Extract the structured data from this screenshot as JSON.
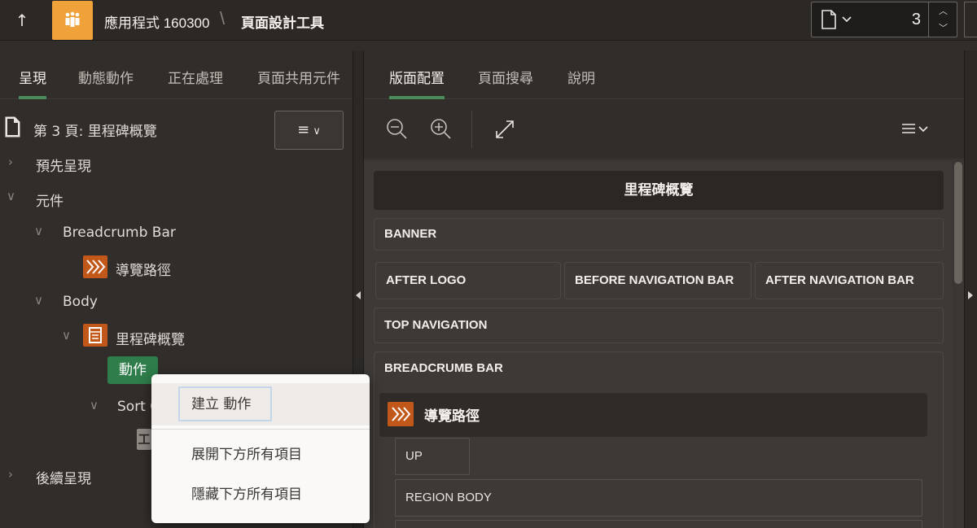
{
  "header": {
    "app_name": "應用程式 160300",
    "separator": "\\",
    "tool_name": "頁面設計工具",
    "page_number": "3"
  },
  "left_tabs": [
    {
      "label": "呈現",
      "active": true
    },
    {
      "label": "動態動作",
      "active": false
    },
    {
      "label": "正在處理",
      "active": false
    },
    {
      "label": "頁面共用元件",
      "active": false
    }
  ],
  "tree": {
    "page_label": "第 3 頁: 里程碑概覽",
    "pre_rendering": "預先呈現",
    "components": "元件",
    "breadcrumb_bar": "Breadcrumb Bar",
    "breadcrumb_item": "導覽路徑",
    "body": "Body",
    "region": "里程碑概覽",
    "actions_badge": "動作",
    "sort_partial": "Sort C",
    "grey_badge": "工",
    "post_rendering": "後續呈現"
  },
  "right_tabs": [
    {
      "label": "版面配置",
      "active": true
    },
    {
      "label": "頁面搜尋",
      "active": false
    },
    {
      "label": "說明",
      "active": false
    }
  ],
  "layout": {
    "page_title": "里程碑概覽",
    "banner": "BANNER",
    "after_logo": "AFTER LOGO",
    "before_nav": "BEFORE NAVIGATION BAR",
    "after_nav": "AFTER NAVIGATION BAR",
    "top_nav": "TOP NAVIGATION",
    "breadcrumb_bar": "BREADCRUMB BAR",
    "breadcrumb_region": "導覽路徑",
    "up": "UP",
    "region_body": "REGION BODY"
  },
  "context_menu": {
    "create_action": "建立 動作",
    "expand_all": "展開下方所有項目",
    "collapse_all": "隱藏下方所有項目"
  },
  "colors": {
    "accent_green": "#4e8a5c",
    "app_icon": "#f0a23a",
    "region_icon": "#c2571a",
    "badge_green": "#2e7d4a"
  }
}
